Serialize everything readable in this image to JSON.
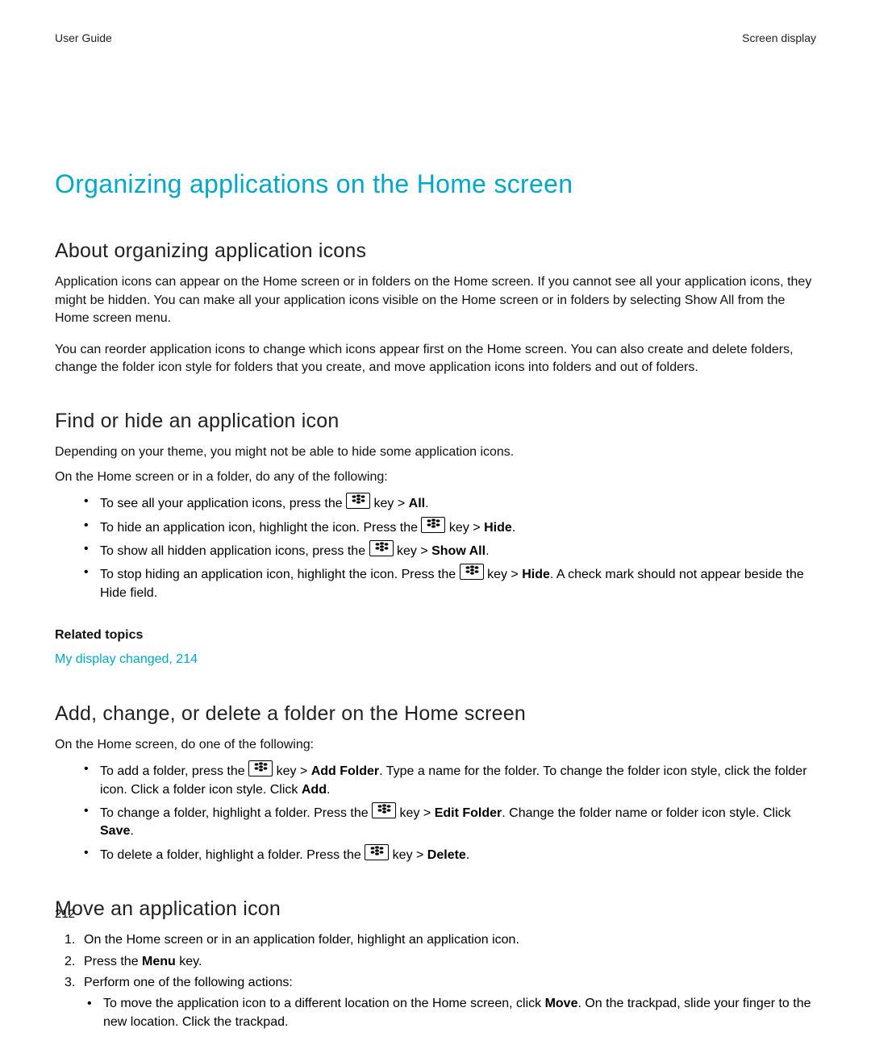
{
  "header": {
    "left": "User Guide",
    "right": "Screen display"
  },
  "title": "Organizing applications on the Home screen",
  "s1": {
    "heading": "About organizing application icons",
    "p1": "Application icons can appear on the Home screen or in folders on the Home screen. If you cannot see all your application icons, they might be hidden. You can make all your application icons visible on the Home screen or in folders by selecting Show All from the Home screen menu.",
    "p2": "You can reorder application icons to change which icons appear first on the Home screen. You can also create and delete folders, change the folder icon style for folders that you create, and move application icons into folders and out of folders."
  },
  "s2": {
    "heading": "Find or hide an application icon",
    "p1": "Depending on your theme, you might not be able to hide some application icons.",
    "p2": "On the Home screen or in a folder, do any of the following:",
    "b1_pre": "To see all your application icons, press the ",
    "b1_post_key": " key > ",
    "b1_bold": "All",
    "b1_end": ".",
    "b2_pre": "To hide an application icon, highlight the icon. Press the ",
    "b2_post_key": " key > ",
    "b2_bold": "Hide",
    "b2_end": ".",
    "b3_pre": "To show all hidden application icons, press the ",
    "b3_post_key": " key > ",
    "b3_bold": "Show All",
    "b3_end": ".",
    "b4_pre": "To stop hiding an application icon, highlight the icon. Press the ",
    "b4_post_key": " key > ",
    "b4_bold": "Hide",
    "b4_end": ". A check mark should not appear beside the Hide field.",
    "related_heading": "Related topics",
    "related_link": "My display changed, 214"
  },
  "s3": {
    "heading": "Add, change, or delete a folder on the Home screen",
    "p1": "On the Home screen, do one of the following:",
    "b1_pre": "To add a folder, press the ",
    "b1_post_key": " key > ",
    "b1_bold": "Add Folder",
    "b1_mid": ". Type a name for the folder. To change the folder icon style, click the folder icon. Click a folder icon style. Click ",
    "b1_bold2": "Add",
    "b1_end": ".",
    "b2_pre": "To change a folder, highlight a folder. Press the ",
    "b2_post_key": " key > ",
    "b2_bold": "Edit Folder",
    "b2_mid": ". Change the folder name or folder icon style. Click ",
    "b2_bold2": "Save",
    "b2_end": ".",
    "b3_pre": "To delete a folder, highlight a folder. Press the ",
    "b3_post_key": " key > ",
    "b3_bold": "Delete",
    "b3_end": "."
  },
  "s4": {
    "heading": "Move an application icon",
    "n1": "On the Home screen or in an application folder, highlight an application icon.",
    "n2_pre": "Press the ",
    "n2_bold": "Menu",
    "n2_end": " key.",
    "n3": "Perform one of the following actions:",
    "n3b1_pre": "To move the application icon to a different location on the Home screen, click ",
    "n3b1_bold": "Move",
    "n3b1_end": ". On the trackpad, slide your finger to the new location. Click the trackpad."
  },
  "page_number": "212"
}
